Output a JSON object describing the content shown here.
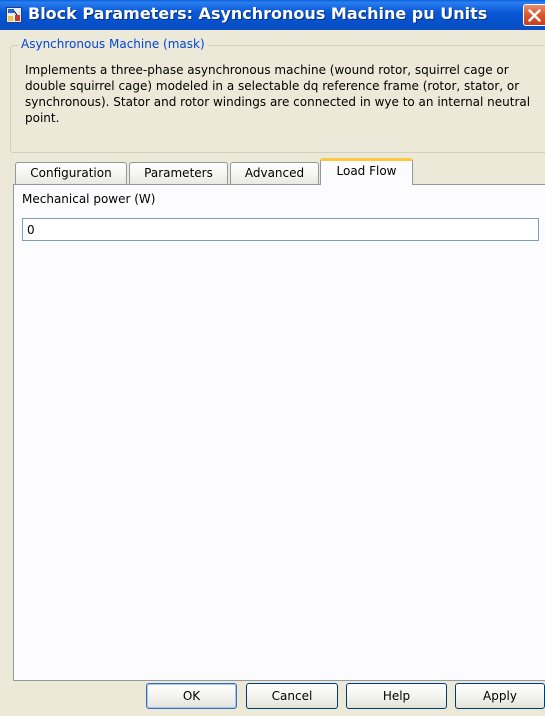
{
  "window": {
    "title": "Block Parameters: Asynchronous Machine pu Units"
  },
  "mask": {
    "group_title": "Asynchronous Machine (mask)",
    "description": "Implements a three-phase asynchronous machine (wound rotor, squirrel cage or double squirrel cage) modeled in a selectable dq reference frame (rotor, stator, or synchronous). Stator and rotor windings are connected in wye to an internal neutral point."
  },
  "tabs": [
    {
      "label": "Configuration",
      "active": false
    },
    {
      "label": "Parameters",
      "active": false
    },
    {
      "label": "Advanced",
      "active": false
    },
    {
      "label": "Load Flow",
      "active": true
    }
  ],
  "load_flow": {
    "mechanical_power_label": "Mechanical power (W)",
    "mechanical_power_value": "0"
  },
  "buttons": {
    "ok": "OK",
    "cancel": "Cancel",
    "help": "Help",
    "apply": "Apply"
  },
  "icons": {
    "title_icon": "block-parameters-icon",
    "close": "close-icon"
  },
  "colors": {
    "titlebar": "#0a58d6",
    "close_button": "#d6572f",
    "active_tab_accent": "#ffc83c",
    "group_title": "#0046d5",
    "window_background": "#ece9d8"
  }
}
